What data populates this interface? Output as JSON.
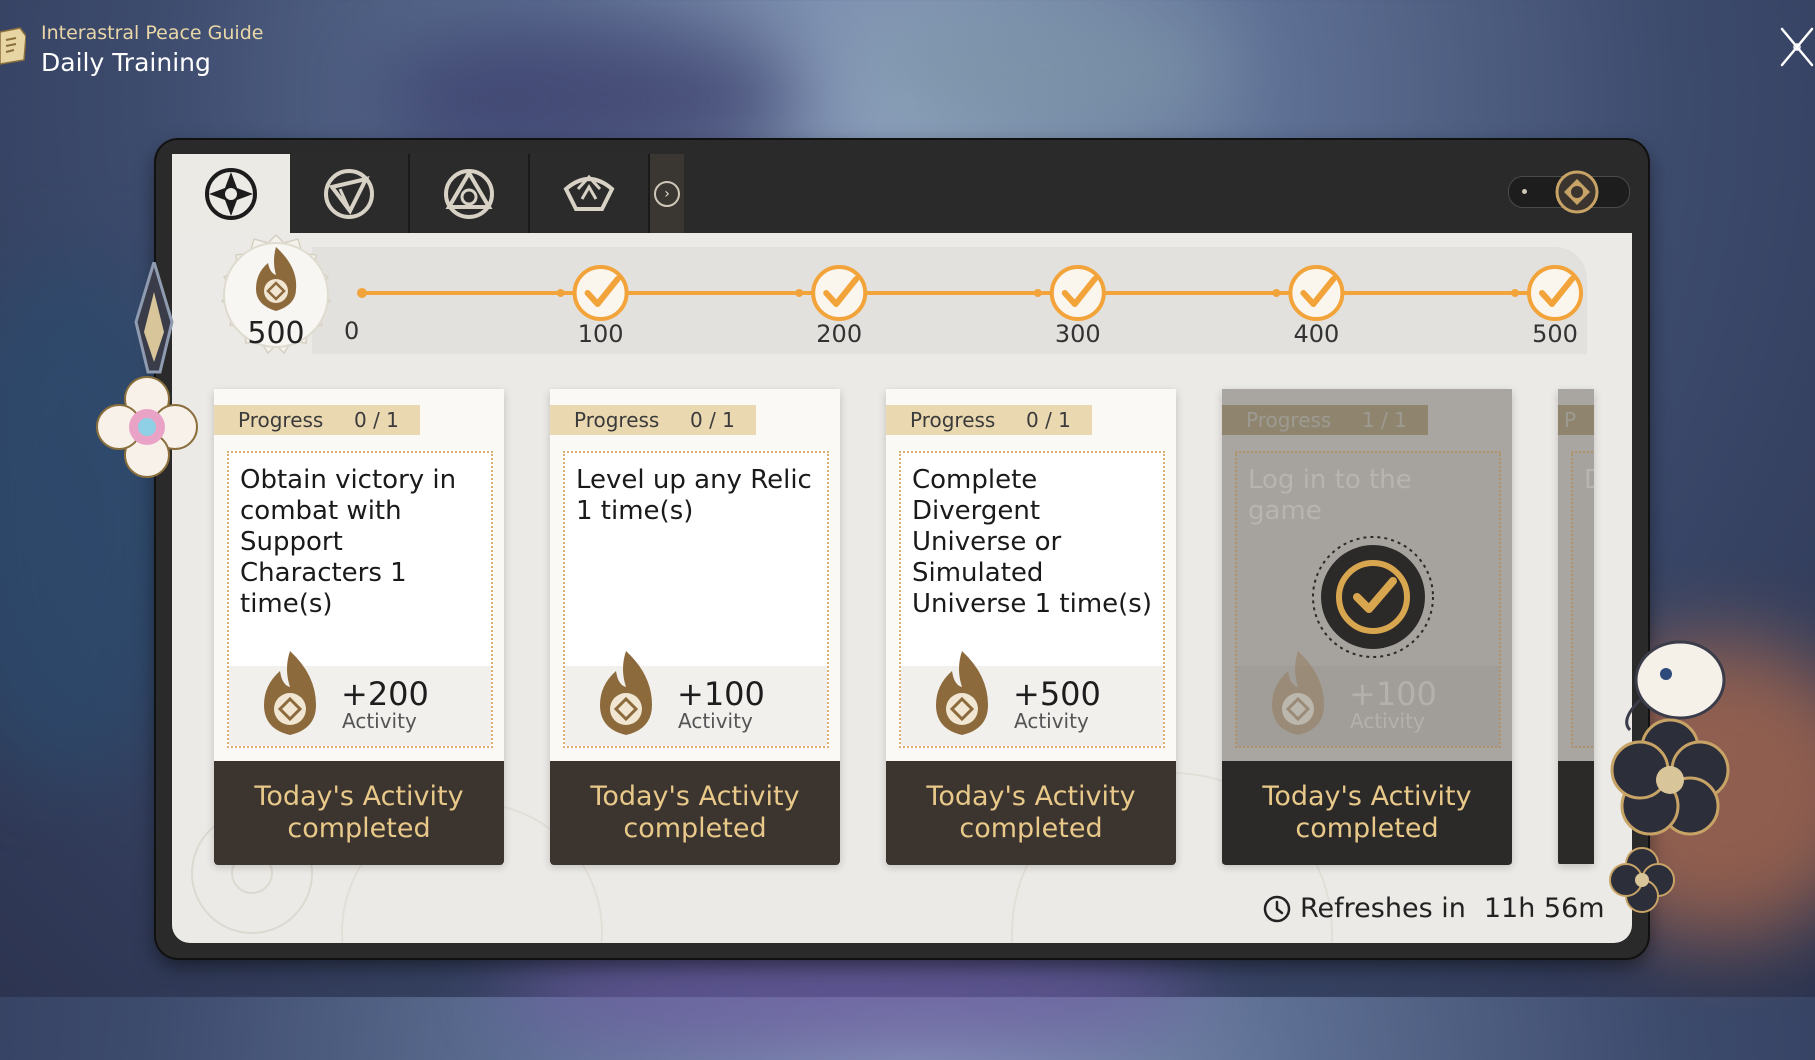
{
  "header": {
    "subtitle": "Interastral Peace Guide",
    "title": "Daily Training"
  },
  "tabs": [
    {
      "icon": "daily-training-tab-icon",
      "active": true
    },
    {
      "icon": "nameless-honor-tab-icon",
      "active": false
    },
    {
      "icon": "trailblaze-tab-icon",
      "active": false
    },
    {
      "icon": "treasures-tab-icon",
      "active": false
    }
  ],
  "total_activity": {
    "value": "500"
  },
  "milestones": [
    {
      "label": "0",
      "completed": false
    },
    {
      "label": "100",
      "completed": true
    },
    {
      "label": "200",
      "completed": true
    },
    {
      "label": "300",
      "completed": true
    },
    {
      "label": "400",
      "completed": true
    },
    {
      "label": "500",
      "completed": true
    }
  ],
  "cards": [
    {
      "progress_label": "Progress",
      "progress_value": "0 / 1",
      "title": "Obtain victory in combat with Support Characters 1 time(s)",
      "reward_amount": "+200",
      "reward_label": "Activity",
      "button": "Today's Activity completed",
      "claimed": false
    },
    {
      "progress_label": "Progress",
      "progress_value": "0 / 1",
      "title": "Level up any Relic 1 time(s)",
      "reward_amount": "+100",
      "reward_label": "Activity",
      "button": "Today's Activity completed",
      "claimed": false
    },
    {
      "progress_label": "Progress",
      "progress_value": "0 / 1",
      "title": "Complete Divergent Universe or Simulated Universe 1 time(s)",
      "reward_amount": "+500",
      "reward_label": "Activity",
      "button": "Today's Activity completed",
      "claimed": false
    },
    {
      "progress_label": "Progress",
      "progress_value": "1 / 1",
      "title": "Log in to the game",
      "reward_amount": "+100",
      "reward_label": "Activity",
      "button": "Today's Activity completed",
      "claimed": true
    }
  ],
  "partial_card": {
    "progress_label": "P",
    "title": "D a"
  },
  "refresh": {
    "label": "Refreshes in",
    "time": "11h 56m"
  },
  "colors": {
    "accent_orange": "#f2a33a",
    "gold_text": "#e9c98a",
    "panel_dark": "#2a2a2a",
    "content_bg": "#ebeae6"
  }
}
